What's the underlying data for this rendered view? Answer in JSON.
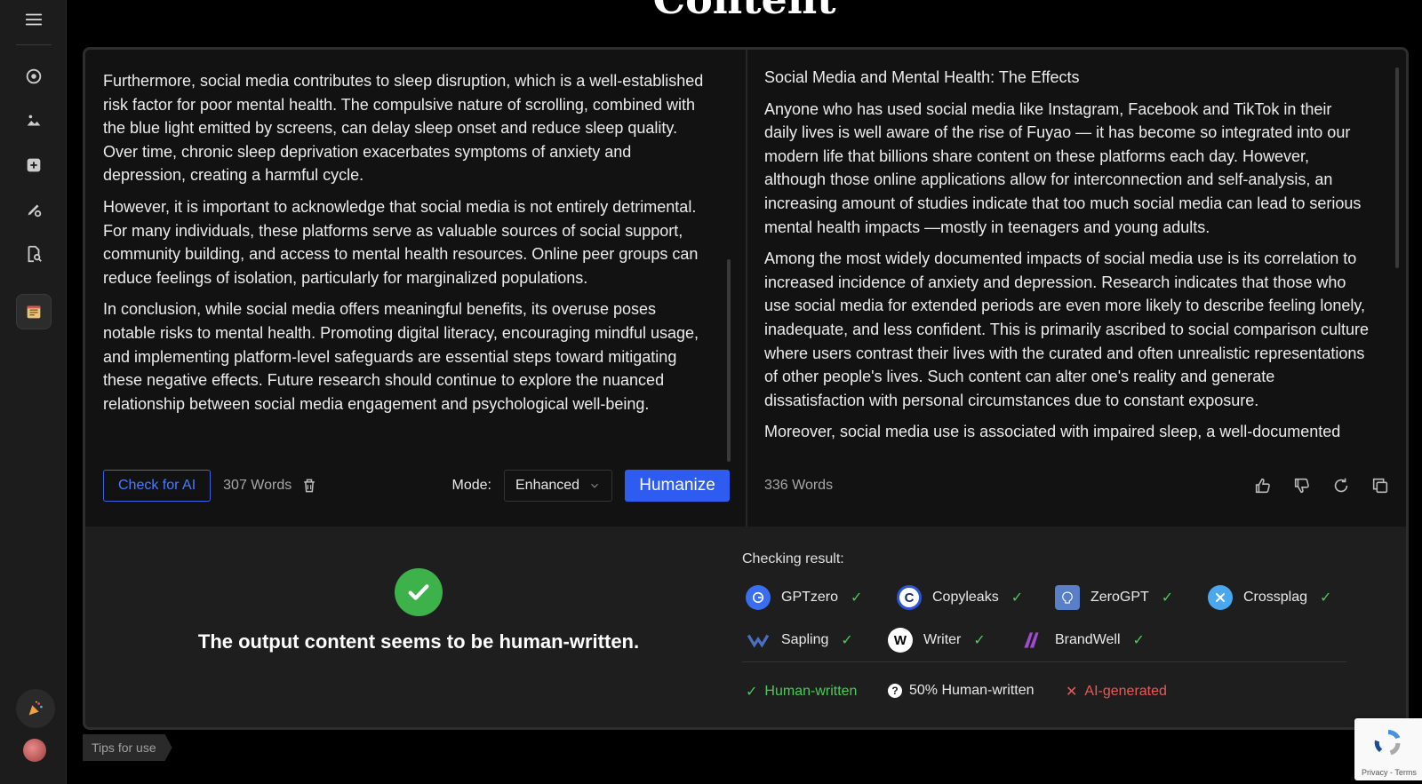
{
  "page": {
    "title": "Content"
  },
  "input": {
    "paragraphs": [
      "Furthermore, social media contributes to sleep disruption, which is a well-established risk factor for poor mental health. The compulsive nature of scrolling, combined with the blue light emitted by screens, can delay sleep onset and reduce sleep quality. Over time, chronic sleep deprivation exacerbates symptoms of anxiety and depression, creating a harmful cycle.",
      "However, it is important to acknowledge that social media is not entirely detrimental. For many individuals, these platforms serve as valuable sources of social support, community building, and access to mental health resources. Online peer groups can reduce feelings of isolation, particularly for marginalized populations.",
      "In conclusion, while social media offers meaningful benefits, its overuse poses notable risks to mental health. Promoting digital literacy, encouraging mindful usage, and implementing platform-level safeguards are essential steps toward mitigating these negative effects. Future research should continue to explore the nuanced relationship between social media engagement and psychological well-being."
    ],
    "check_label": "Check for AI",
    "word_count": "307 Words",
    "mode_label": "Mode:",
    "mode_value": "Enhanced",
    "humanize_label": "Humanize"
  },
  "output": {
    "title": "Social Media and Mental Health: The Effects",
    "paragraphs": [
      "Anyone who has used social media like Instagram, Facebook and TikTok in their daily lives is well aware of the rise of Fuyao — it has become so integrated into our modern life that billions share content on these platforms each day. However, although those online applications allow for interconnection and self-analysis, an increasing amount of studies indicate that too much social media can lead to serious mental health impacts —mostly in teenagers and young adults.",
      "Among the most widely documented impacts of social media use is its correlation to increased incidence of anxiety and depression. Research indicates that those who use social media for extended periods are even more likely to describe feeling lonely, inadequate, and less confident. This is primarily ascribed to social comparison culture where users contrast their lives with the curated and often unrealistic representations of other people's lives. Such content can alter one's reality and generate dissatisfaction with personal circumstances due to constant exposure.",
      "Moreover, social media use is associated with impaired sleep, a well-documented"
    ],
    "word_count": "336 Words"
  },
  "verdict": {
    "text": "The output content seems to be human-written."
  },
  "results": {
    "title": "Checking result:",
    "detectors": [
      {
        "name": "GPTzero",
        "color": "#3a6ef0"
      },
      {
        "name": "Copyleaks",
        "color": "#2c55d6"
      },
      {
        "name": "ZeroGPT",
        "color": "#5a7fc9"
      },
      {
        "name": "Crossplag",
        "color": "#4aa8f0"
      },
      {
        "name": "Sapling",
        "color": "#4a6fc0"
      },
      {
        "name": "Writer",
        "color": "#ffffff"
      },
      {
        "name": "BrandWell",
        "color": "#a04ad0"
      }
    ],
    "legend": {
      "human": "Human-written",
      "half": "50% Human-written",
      "ai": "AI-generated"
    }
  },
  "footer": {
    "tips": "Tips for use",
    "recaptcha_links": "Privacy - Terms"
  }
}
